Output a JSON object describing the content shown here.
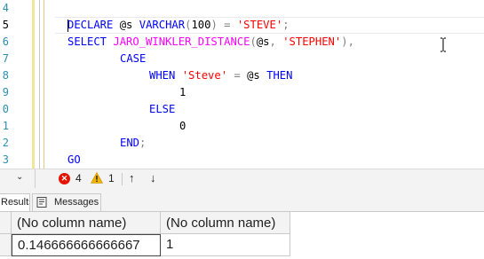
{
  "editor": {
    "line_numbers": [
      "4",
      "5",
      "6",
      "7",
      "8",
      "9",
      "0",
      "1",
      "2",
      "3"
    ],
    "current_line_index": 1,
    "code": {
      "line1": {
        "declare": "DECLARE",
        "var": " @s ",
        "type": "VARCHAR",
        "lparen": "(",
        "num": "100",
        "rparen": ")",
        "eq": " = ",
        "str": "'STEVE'",
        "semi": ";"
      },
      "line2": {
        "select": "SELECT",
        "fn": " JARO_WINKLER_DISTANCE",
        "lparen": "(",
        "var": "@s",
        "comma": ", ",
        "str": "'STEPHEN'",
        "rparen": ")",
        "comma2": ","
      },
      "line3": {
        "case": "CASE"
      },
      "line4": {
        "when": "WHEN",
        "str": " 'Steve'",
        "eq": " = ",
        "var": "@s",
        "then": " THEN"
      },
      "line5": {
        "value": "1"
      },
      "line6": {
        "else": "ELSE"
      },
      "line7": {
        "value": "0"
      },
      "line8": {
        "end": "END",
        "semi": ";"
      },
      "line9": {
        "go": "GO"
      }
    }
  },
  "status": {
    "errors": "4",
    "warnings": "1",
    "zoom_chevron": "⌄",
    "error_glyph": "✕",
    "up_arrow": "↑",
    "down_arrow": "↓"
  },
  "tabs": {
    "results": "Results",
    "messages": "Messages"
  },
  "grid": {
    "columns": [
      "(No column name)",
      "(No column name)"
    ],
    "rows": [
      [
        "0.146666666666667",
        "1"
      ]
    ]
  },
  "icons": {
    "error": "error-circle-icon",
    "warning": "warning-triangle-icon",
    "messages": "messages-icon",
    "cursor": "text-ibeam-cursor-icon"
  },
  "colors": {
    "keyword": "#0000ff",
    "function": "#ff00ff",
    "string": "#ff0000",
    "operator": "#808080",
    "line_number": "#2b91af",
    "error": "#e51400",
    "warning": "#f0b400"
  }
}
